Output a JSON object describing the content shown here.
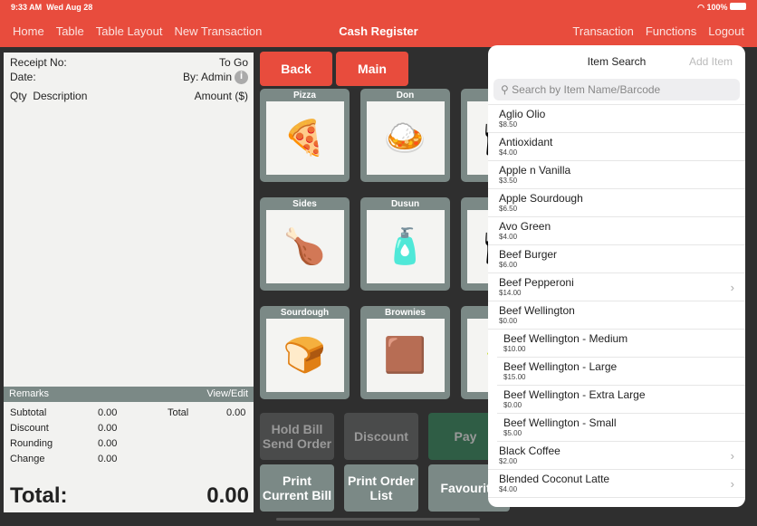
{
  "status": {
    "time": "9:33 AM",
    "date": "Wed Aug 28",
    "battery": "100%"
  },
  "nav": {
    "left": [
      "Home",
      "Table",
      "Table Layout",
      "New Transaction"
    ],
    "title": "Cash Register",
    "right": [
      "Transaction",
      "Functions",
      "Logout"
    ]
  },
  "receipt": {
    "receipt_no": "Receipt No:",
    "to_go": "To Go",
    "date": "Date:",
    "by": "By: Admin",
    "qty": "Qty",
    "desc": "Description",
    "amount": "Amount ($)",
    "remarks": "Remarks",
    "view_edit": "View/Edit",
    "subtotal_label": "Subtotal",
    "subtotal": "0.00",
    "total_label_small": "Total",
    "total_small": "0.00",
    "discount_label": "Discount",
    "discount": "0.00",
    "rounding_label": "Rounding",
    "rounding": "0.00",
    "change_label": "Change",
    "change": "0.00",
    "total_label": "Total:",
    "total": "0.00"
  },
  "buttons": {
    "back": "Back",
    "main": "Main"
  },
  "tiles": [
    {
      "label": "Pizza",
      "icon": "pizza"
    },
    {
      "label": "Don",
      "icon": "rice-bowl"
    },
    {
      "label": "",
      "icon": "dish"
    },
    {
      "label": "Sides",
      "icon": "chicken"
    },
    {
      "label": "Dusun",
      "icon": "bottle"
    },
    {
      "label": "Ta",
      "icon": "dish"
    },
    {
      "label": "Sourdough",
      "icon": "bread"
    },
    {
      "label": "Brownies",
      "icon": "brownie"
    },
    {
      "label": "",
      "icon": "burger"
    }
  ],
  "actions": {
    "hold": "Hold Bill Send Order",
    "discount": "Discount",
    "pay": "Pay",
    "print_bill": "Print Current Bill",
    "print_order": "Print Order List",
    "favourite": "Favourite"
  },
  "popover": {
    "title": "Item Search",
    "add": "Add Item",
    "placeholder": "Search by Item Name/Barcode",
    "items": [
      {
        "name": "Aglio Olio",
        "price": "$8.50"
      },
      {
        "name": "Antioxidant",
        "price": "$4.00"
      },
      {
        "name": "Apple n Vanilla",
        "price": "$3.50"
      },
      {
        "name": "Apple Sourdough",
        "price": "$6.50"
      },
      {
        "name": "Avo Green",
        "price": "$4.00"
      },
      {
        "name": "Beef Burger",
        "price": "$6.00"
      },
      {
        "name": "Beef Pepperoni",
        "price": "$14.00",
        "chevron": true
      },
      {
        "name": "Beef Wellington",
        "price": "$0.00"
      },
      {
        "name": "Beef Wellington - Medium",
        "price": "$10.00",
        "sub": true
      },
      {
        "name": "Beef Wellington - Large",
        "price": "$15.00",
        "sub": true
      },
      {
        "name": "Beef Wellington - Extra Large",
        "price": "$0.00",
        "sub": true
      },
      {
        "name": "Beef Wellington - Small",
        "price": "$5.00",
        "sub": true
      },
      {
        "name": "Black Coffee",
        "price": "$2.00",
        "chevron": true
      },
      {
        "name": "Blended Coconut Latte",
        "price": "$4.00",
        "chevron": true
      }
    ]
  },
  "colors": {
    "accent": "#e84c3d",
    "tile": "#7b8986",
    "pay": "#2f5d45"
  }
}
